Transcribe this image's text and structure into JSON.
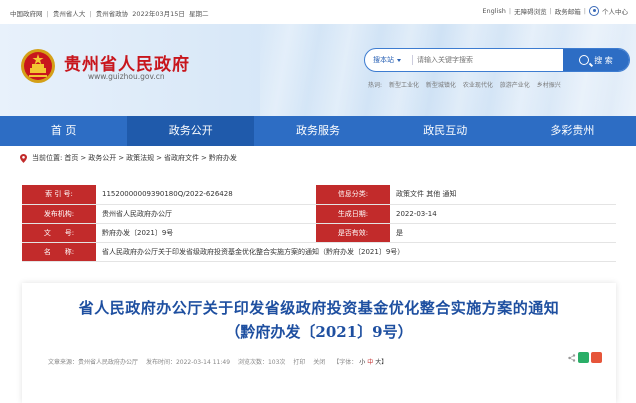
{
  "topbar": {
    "links_left": [
      "中国政府网",
      "|",
      "贵州省人大",
      "|",
      "贵州省政协",
      "2022年03月15日",
      "星期二"
    ],
    "links_right": [
      "English",
      "|",
      "无障碍浏览",
      "|",
      "政务邮箱",
      "|",
      "个人中心"
    ]
  },
  "site": {
    "name": "贵州省人民政府",
    "domain": "www.guizhou.gov.cn"
  },
  "search": {
    "scope": "搜本站",
    "placeholder": "请输入关键字搜索",
    "button": "搜 索",
    "hot_label": "热词:",
    "hot_words": [
      "新型工业化",
      "新型城镇化",
      "农业现代化",
      "旅游产业化",
      "乡村振兴"
    ]
  },
  "nav": {
    "items": [
      "首 页",
      "政务公开",
      "政务服务",
      "政民互动",
      "多彩贵州"
    ],
    "active": "政务公开"
  },
  "breadcrumb": {
    "label": "当前位置:",
    "items": [
      "首页",
      ">",
      "政务公开",
      ">",
      "政策法规",
      ">",
      "省政府文件",
      ">",
      "黔府办发"
    ]
  },
  "info": {
    "index_label": "索 引 号:",
    "index_value": "11520000009390180Q/2022-626428",
    "category_label": "信息分类:",
    "category_value": "政策文件  其他  通知",
    "issuer_label": "发布机构:",
    "issuer_value": "贵州省人民政府办公厅",
    "date_label": "生成日期:",
    "date_value": "2022-03-14",
    "docno_label": "文　　号:",
    "docno_value": "黔府办发〔2021〕9号",
    "valid_label": "是否有效:",
    "valid_value": "是",
    "name_label": "名　　称:",
    "name_value": "省人民政府办公厅关于印发省级政府投资基金优化整合实施方案的通知（黔府办发〔2021〕9号）"
  },
  "article": {
    "title": "省人民政府办公厅关于印发省级政府投资基金优化整合实施方案的通知",
    "subtitle": "（黔府办发〔2021〕9号）",
    "source": "文章来源：贵州省人民政府办公厅",
    "published": "发布时间：2022-03-14 11:49",
    "views": "浏览次数：103次",
    "print": "打印",
    "close": "关闭",
    "font_label": "【字体：",
    "font_small": "小",
    "font_mid": "中",
    "font_large": "大】"
  },
  "colors": {
    "brand_red": "#c8161d",
    "nav_blue": "#2d6dc4",
    "label_red": "#c22b2b",
    "title_blue": "#1e4fa0"
  }
}
